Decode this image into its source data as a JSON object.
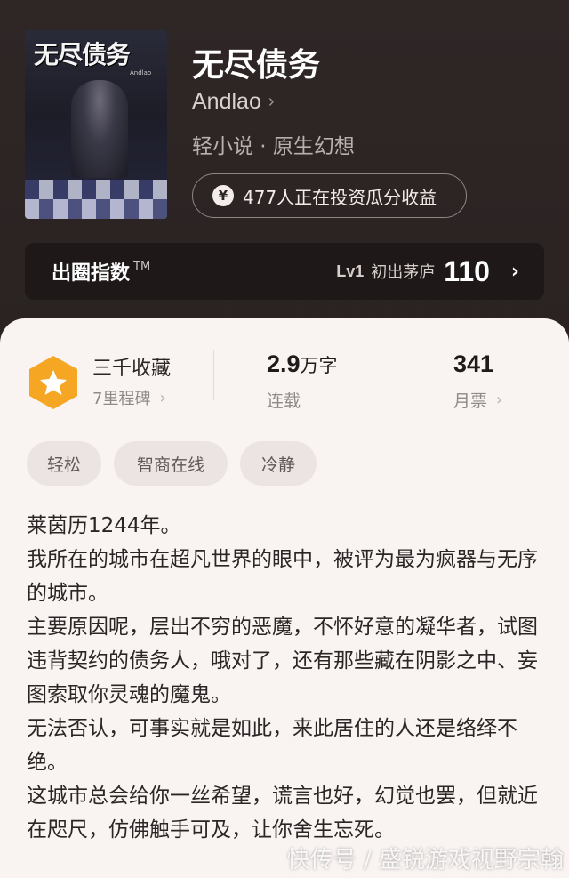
{
  "book": {
    "cover_title": "无尽债务",
    "cover_author": "Andlao",
    "title": "无尽债务",
    "author": "Andlao",
    "genre": "轻小说 · 原生幻想",
    "invest_text": "477人正在投资瓜分收益"
  },
  "index_bar": {
    "label": "出圈指数",
    "tm": "TM",
    "level": "Lv1",
    "level_name": "初出茅庐",
    "value": "110"
  },
  "stats": {
    "collect_title": "三千收藏",
    "collect_sub": "7里程碑",
    "words_value": "2.9",
    "words_unit": "万字",
    "words_sub": "连载",
    "tickets_value": "341",
    "tickets_sub": "月票"
  },
  "tags": [
    "轻松",
    "智商在线",
    "冷静"
  ],
  "description": [
    "莱茵历1244年。",
    "我所在的城市在超凡世界的眼中，被评为最为疯器与无序的城市。",
    "主要原因呢，层出不穷的恶魔，不怀好意的凝华者，试图违背契约的债务人，哦对了，还有那些藏在阴影之中、妄图索取你灵魂的魔鬼。",
    "无法否认，可事实就是如此，来此居住的人还是络绎不绝。",
    "这城市总会给你一丝希望，谎言也好，幻觉也罢，但就近在咫尺，仿佛触手可及，让你舍生忘死。"
  ],
  "watermark": "快传号 / 盛锐游戏视野宗翰",
  "icons": {
    "author_chevron": "chevron-right-icon",
    "yen": "yen-coin-icon",
    "index_chevron": "chevron-right-icon",
    "badge": "star-hexagon-badge-icon"
  },
  "colors": {
    "header_bg": "#2b2423",
    "panel_bg": "#f9f3f1",
    "badge_orange": "#f5a623"
  }
}
